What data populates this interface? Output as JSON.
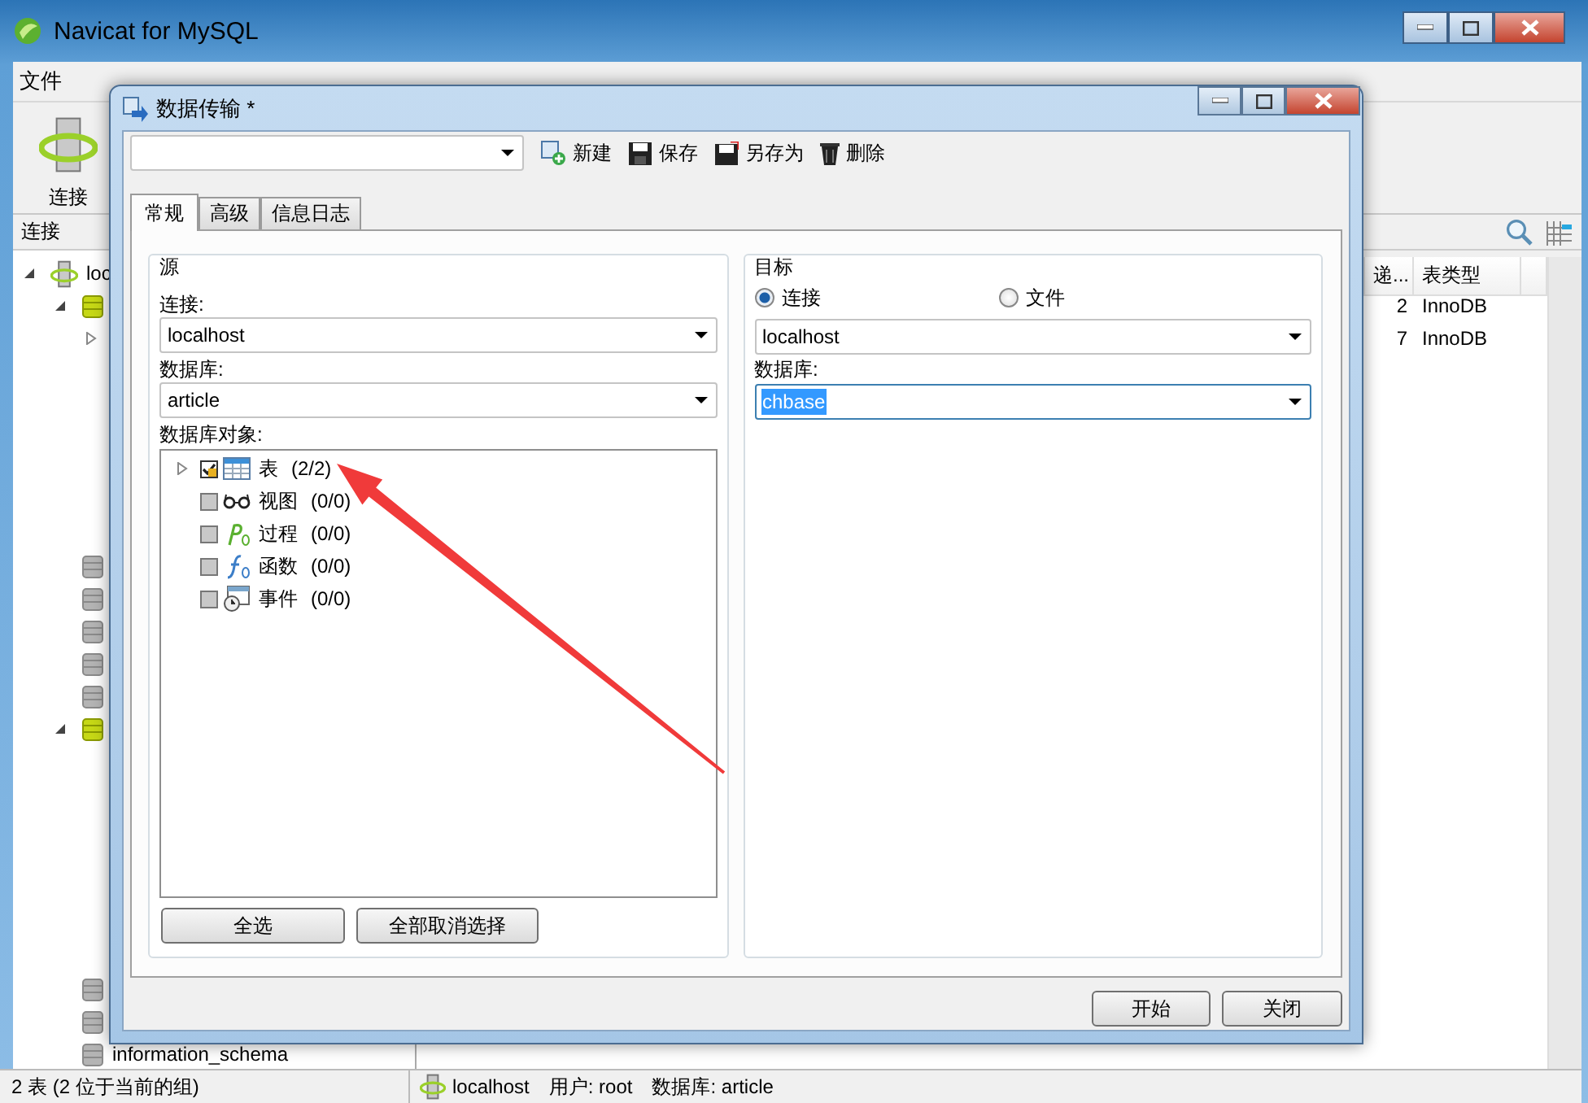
{
  "main_window": {
    "title": "Navicat for MySQL",
    "menu": [
      "文件"
    ],
    "toolbar": [
      {
        "label": "连接"
      }
    ],
    "connection_pane": {
      "header": "连接",
      "tree": [
        {
          "kind": "server",
          "label": "loc",
          "expanded": true,
          "children": [
            {
              "kind": "database",
              "open": true,
              "expanded": true,
              "children": [
                {
                  "expanded": false
                }
              ]
            },
            {
              "kind": "database",
              "open": false
            },
            {
              "kind": "database",
              "open": false
            },
            {
              "kind": "database",
              "open": false
            },
            {
              "kind": "database",
              "open": false
            },
            {
              "kind": "database",
              "open": false
            },
            {
              "kind": "database",
              "open": true,
              "expanded": true
            },
            {
              "kind": "database",
              "open": false
            },
            {
              "kind": "database",
              "open": false
            },
            {
              "kind": "database",
              "open": false,
              "label": "information_schema"
            }
          ]
        }
      ]
    },
    "objects_table": {
      "columns": [
        "递...",
        "表类型"
      ],
      "rows": [
        [
          "2",
          "InnoDB"
        ],
        [
          "7",
          "InnoDB"
        ]
      ]
    },
    "status_bar": {
      "summary": "2 表 (2 位于当前的组)",
      "connection": "localhost",
      "user": "用户: root",
      "database": "数据库: article"
    }
  },
  "dialog": {
    "title": "数据传输 *",
    "toolbar": [
      {
        "kind": "new",
        "label": "新建"
      },
      {
        "kind": "save",
        "label": "保存"
      },
      {
        "kind": "save_as",
        "label": "另存为"
      },
      {
        "kind": "delete",
        "label": "删除"
      }
    ],
    "tabs": [
      {
        "label": "常规",
        "selected": true
      },
      {
        "label": "高级",
        "selected": false
      },
      {
        "label": "信息日志",
        "selected": false
      }
    ],
    "source": {
      "legend": "源",
      "connection_label": "连接:",
      "connection": "localhost",
      "database_label": "数据库:",
      "database": "article",
      "objects_label": "数据库对象:",
      "objects": [
        {
          "kind": "table",
          "label": "表",
          "count": "(2/2)",
          "checked": true,
          "expandable": true
        },
        {
          "kind": "view",
          "label": "视图",
          "count": "(0/0)",
          "checked": false,
          "expandable": false
        },
        {
          "kind": "procedure",
          "label": "过程",
          "count": "(0/0)",
          "checked": false,
          "expandable": false
        },
        {
          "kind": "function",
          "label": "函数",
          "count": "(0/0)",
          "checked": false,
          "expandable": false
        },
        {
          "kind": "event",
          "label": "事件",
          "count": "(0/0)",
          "checked": false,
          "expandable": false
        }
      ],
      "buttons": [
        "全选",
        "全部取消选择"
      ]
    },
    "target": {
      "legend": "目标",
      "modes": [
        {
          "label": "连接",
          "selected": true
        },
        {
          "label": "文件",
          "selected": false
        }
      ],
      "connection": "localhost",
      "database_label": "数据库:",
      "database": "chbase",
      "database_highlighted": true
    },
    "buttons": [
      "开始",
      "关闭"
    ]
  }
}
